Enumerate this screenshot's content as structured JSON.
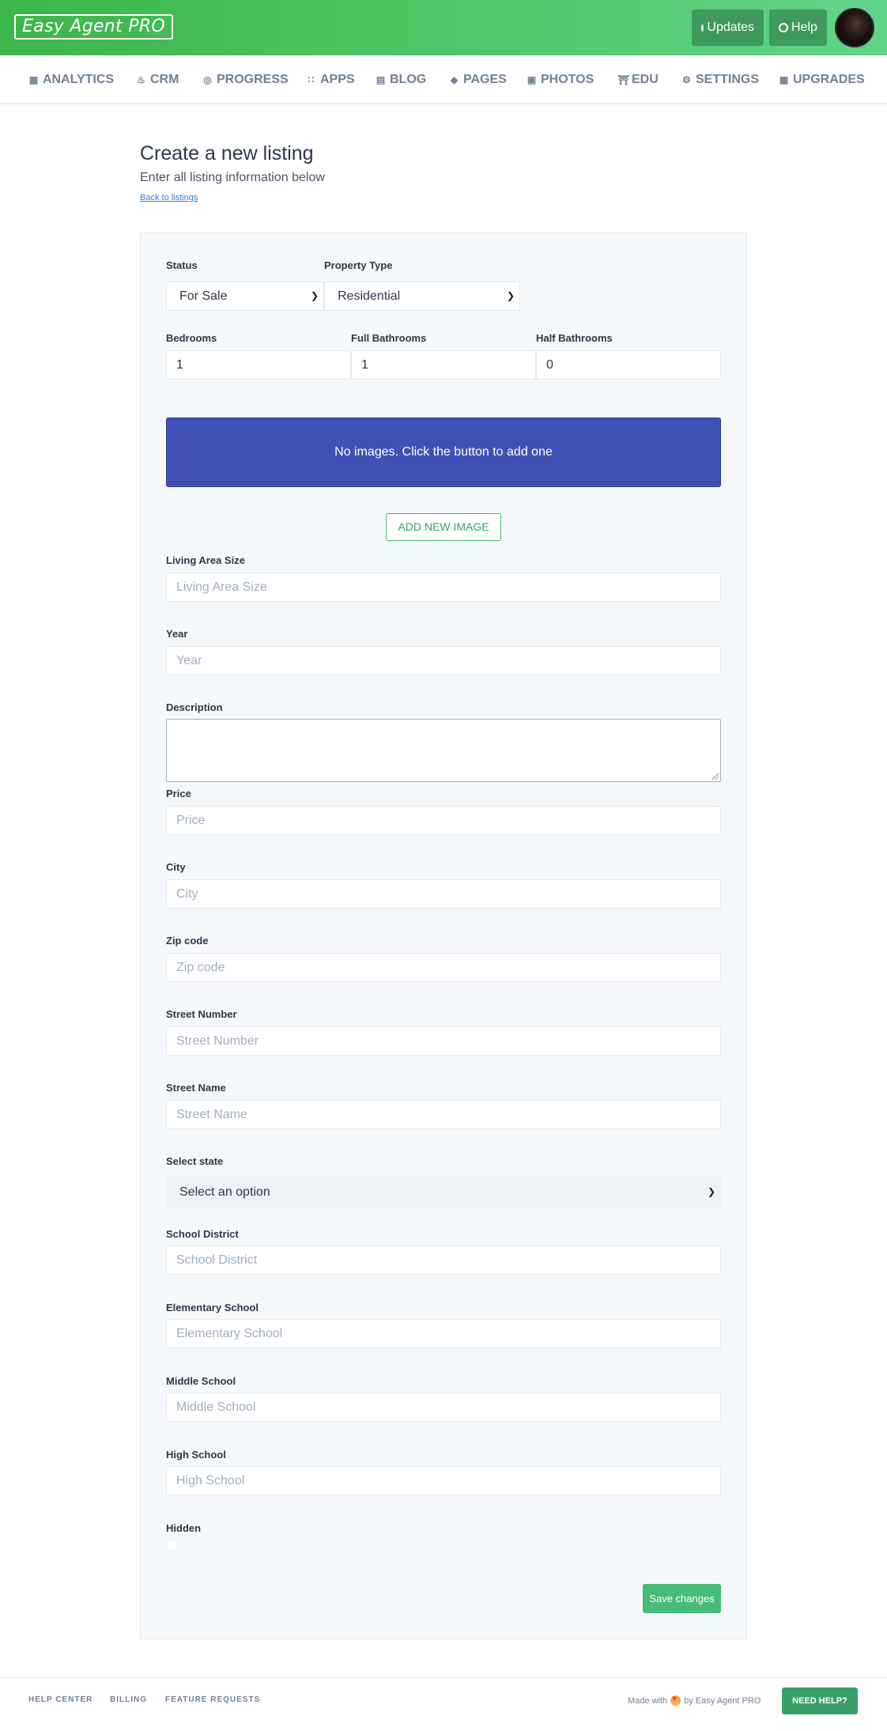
{
  "header": {
    "logo_text": "Easy Agent PRO",
    "updates_label": "Updates",
    "help_label": "Help"
  },
  "nav": {
    "items": [
      {
        "label": "ANALYTICS",
        "icon": "grid-icon"
      },
      {
        "label": "CRM",
        "icon": "fire-icon"
      },
      {
        "label": "PROGRESS",
        "icon": "target-icon"
      },
      {
        "label": "APPS",
        "icon": "dots-grid-icon"
      },
      {
        "label": "BLOG",
        "icon": "newspaper-icon"
      },
      {
        "label": "PAGES",
        "icon": "layers-icon"
      },
      {
        "label": "PHOTOS",
        "icon": "camera-icon"
      },
      {
        "label": "EDU",
        "icon": "university-icon"
      },
      {
        "label": "SETTINGS",
        "icon": "gear-icon"
      },
      {
        "label": "UPGRADES",
        "icon": "store-icon"
      }
    ]
  },
  "page": {
    "title": "Create a new listing",
    "subtitle": "Enter all listing information below",
    "back_link": "Back to listings"
  },
  "form": {
    "status": {
      "label": "Status",
      "value": "For Sale"
    },
    "property_type": {
      "label": "Property Type",
      "value": "Residential"
    },
    "bedrooms": {
      "label": "Bedrooms",
      "value": "1"
    },
    "full_bathrooms": {
      "label": "Full Bathrooms",
      "value": "1"
    },
    "half_bathrooms": {
      "label": "Half Bathrooms",
      "value": "0"
    },
    "images_message": "No images. Click the button to add one",
    "add_image_button": "ADD NEW IMAGE",
    "living_area": {
      "label": "Living Area Size",
      "placeholder": "Living Area Size"
    },
    "year": {
      "label": "Year",
      "placeholder": "Year"
    },
    "description": {
      "label": "Description"
    },
    "price": {
      "label": "Price",
      "placeholder": "Price"
    },
    "city": {
      "label": "City",
      "placeholder": "City"
    },
    "zip": {
      "label": "Zip code",
      "placeholder": "Zip code"
    },
    "street_number": {
      "label": "Street Number",
      "placeholder": "Street Number"
    },
    "street_name": {
      "label": "Street Name",
      "placeholder": "Street Name"
    },
    "state": {
      "label": "Select state",
      "value": "Select an option"
    },
    "school_district": {
      "label": "School District",
      "placeholder": "School District"
    },
    "elementary_school": {
      "label": "Elementary School",
      "placeholder": "Elementary School"
    },
    "middle_school": {
      "label": "Middle School",
      "placeholder": "Middle School"
    },
    "high_school": {
      "label": "High School",
      "placeholder": "High School"
    },
    "hidden": {
      "label": "Hidden"
    },
    "save_button": "Save changes"
  },
  "footer": {
    "links": [
      "HELP CENTER",
      "BILLING",
      "FEATURE REQUESTS"
    ],
    "made_with_prefix": "Made with",
    "made_with_suffix": "by Easy Agent PRO",
    "need_help_button": "NEED HELP?"
  },
  "colors": {
    "header_green": "#3cb54a",
    "accent_blue": "#3f51b5",
    "button_green": "#48bb78"
  }
}
